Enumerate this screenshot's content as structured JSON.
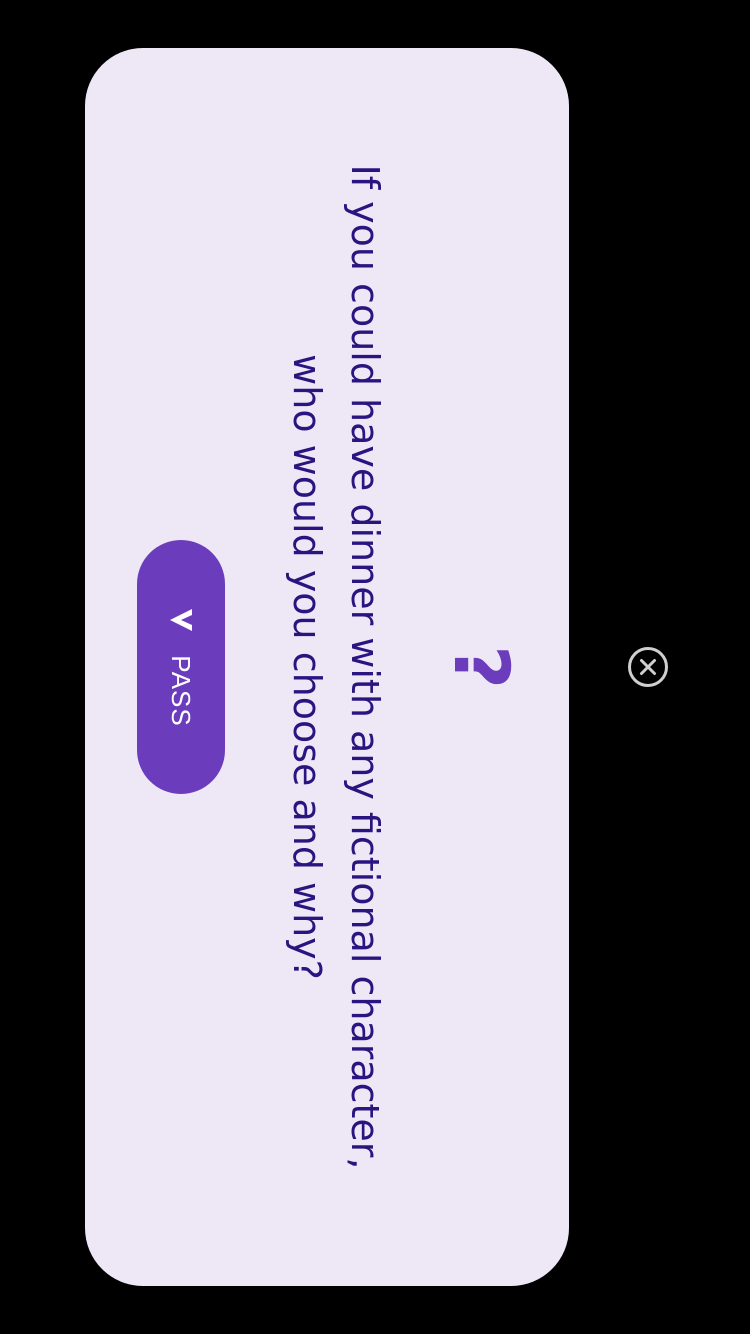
{
  "card": {
    "icon": "question-mark-icon",
    "question_mark": "?",
    "question": "If you could have dinner with any fictional character, who would you choose and why?"
  },
  "pass_button": {
    "icon": "chevron-down-icon",
    "label": "PASS"
  },
  "close_button": {
    "icon": "close-circle-icon"
  },
  "colors": {
    "background": "#000000",
    "card": "#EEE8F6",
    "accent": "#6B3DBC",
    "question_text": "#2A1480"
  }
}
